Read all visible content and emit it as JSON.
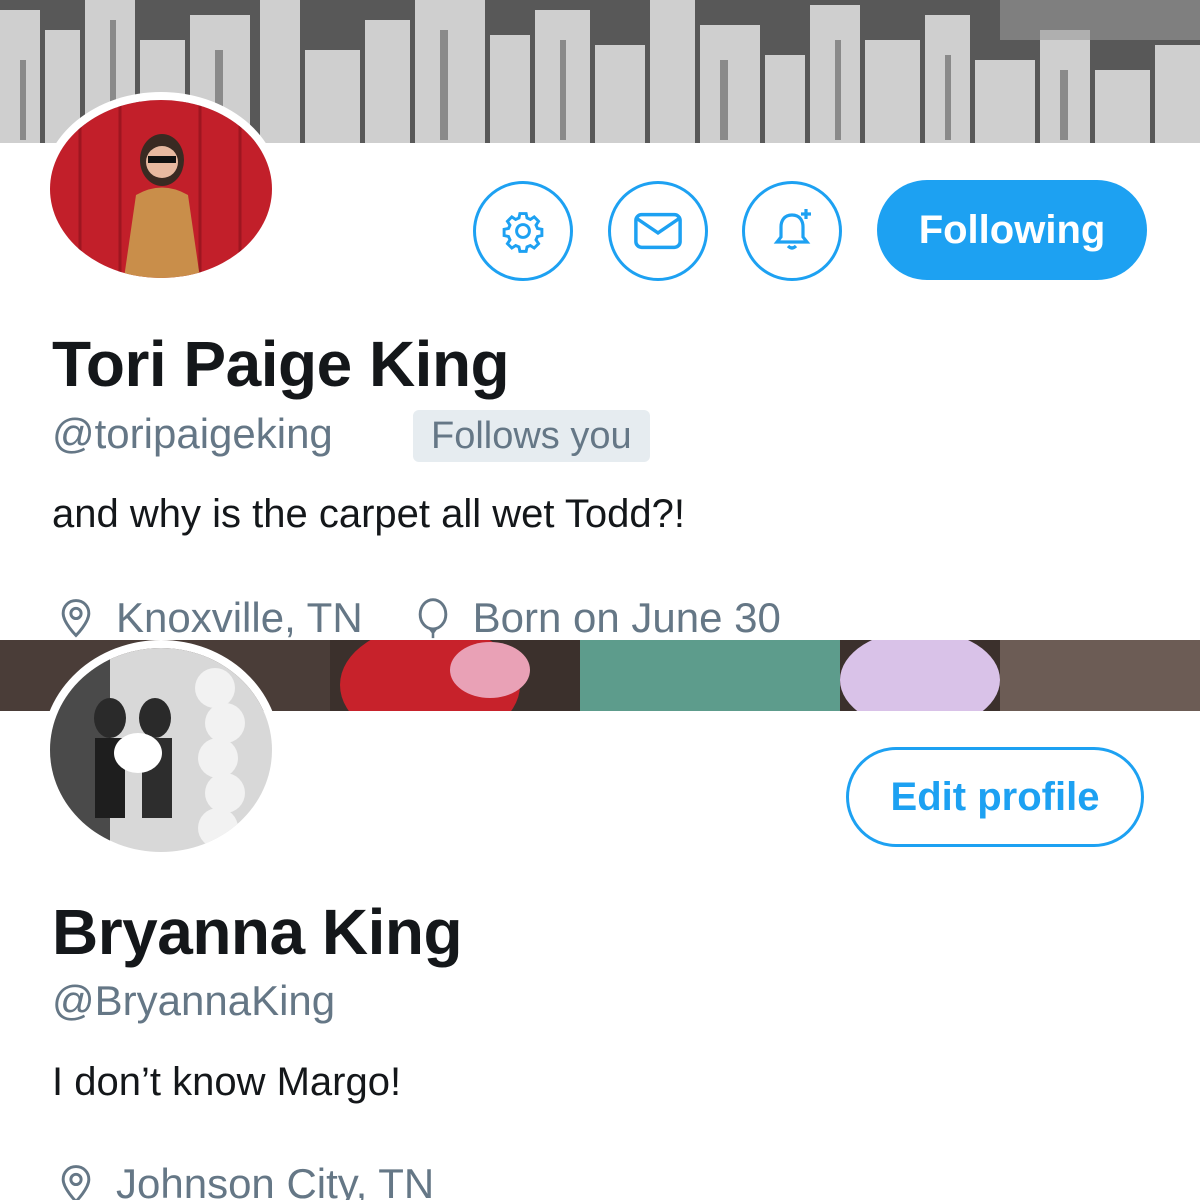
{
  "profile_1": {
    "name": "Tori Paige King",
    "handle": "@toripaigeking",
    "follows_badge": "Follows you",
    "bio": "and why is the carpet all wet Todd?!",
    "location": "Knoxville, TN",
    "birthday": "Born on June 30",
    "buttons": {
      "settings_icon": "gear-icon",
      "message_icon": "envelope-icon",
      "notify_icon": "bell-plus-icon",
      "following_label": "Following"
    }
  },
  "profile_2": {
    "name": "Bryanna King",
    "handle": "@BryannaKing",
    "bio": "I don’t know Margo!",
    "location": "Johnson City, TN",
    "edit_label": "Edit profile"
  },
  "colors": {
    "accent": "#1da1f2",
    "secondary_text": "#657786",
    "primary_text": "#14171a",
    "badge_bg": "#e6ecf0"
  }
}
